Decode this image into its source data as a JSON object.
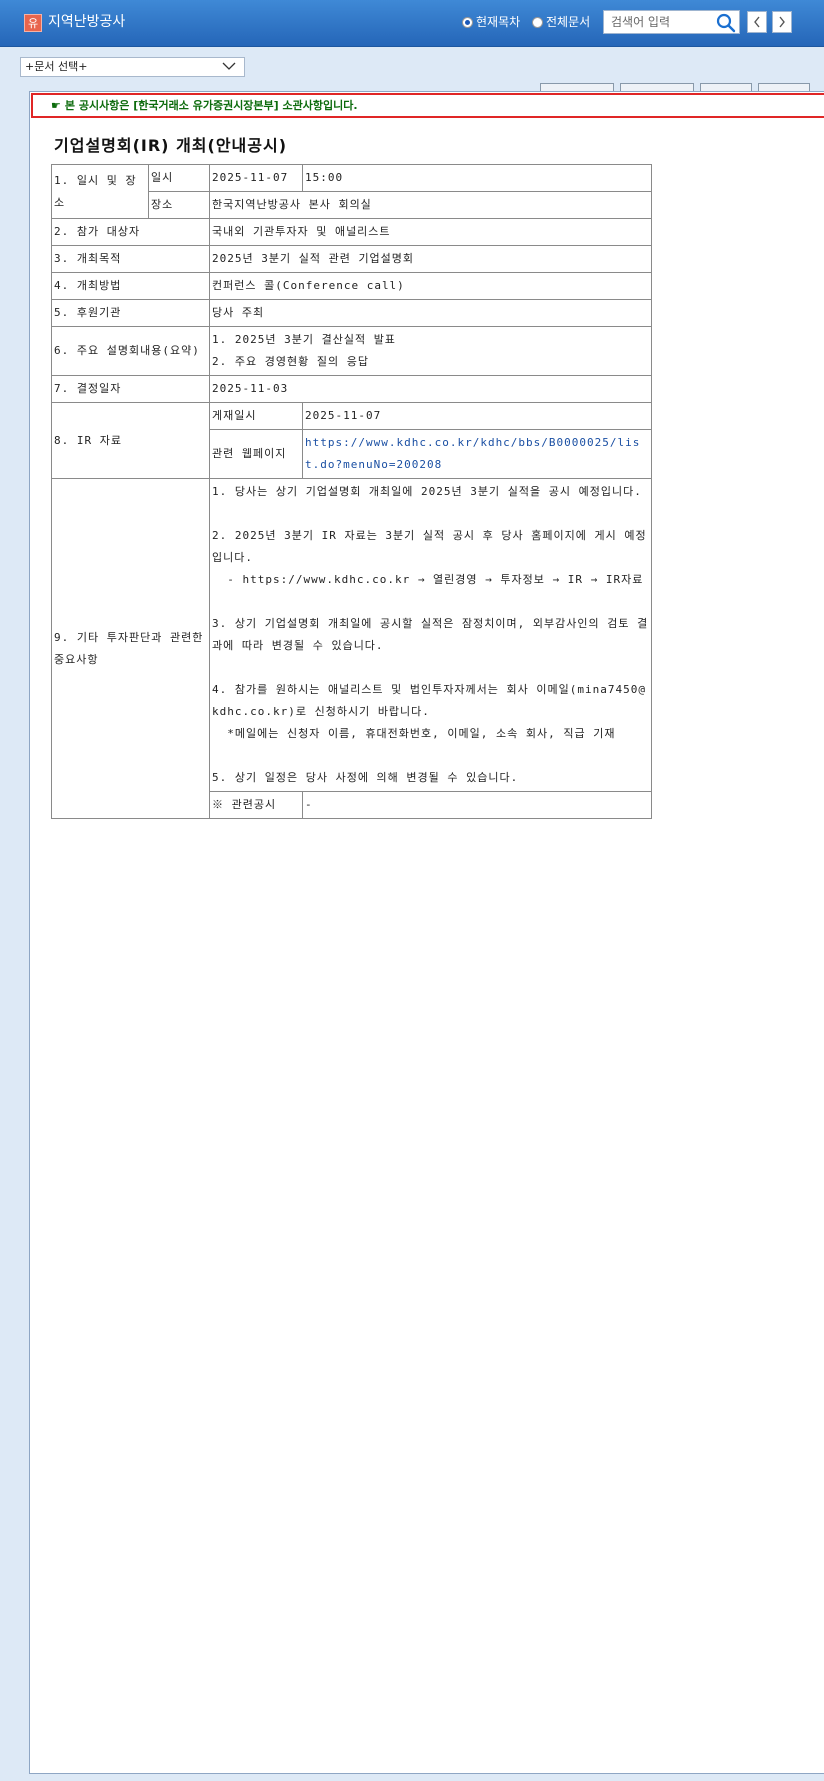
{
  "header": {
    "company_icon": "유",
    "company_name": "지역난방공사",
    "radio_current": "현재목차",
    "radio_all": "전체문서",
    "search_placeholder": "검색어 입력"
  },
  "doc_select": {
    "label": "+문서 선택+"
  },
  "notice": {
    "text": "본 공시사항은 [한국거래소 유가증권시장본부] 소관사항입니다."
  },
  "report": {
    "title": "기업설명회(IR) 개최(안내공시)",
    "rows": {
      "r1_label": "1. 일시 및 장소",
      "r1_date_label": "일시",
      "r1_date": "2025-11-07",
      "r1_time": "15:00",
      "r1_place_label": "장소",
      "r1_place": "한국지역난방공사 본사 회의실",
      "r2_label": "2. 참가 대상자",
      "r2_value": "국내외 기관투자자 및 애널리스트",
      "r3_label": "3. 개최목적",
      "r3_value": "2025년 3분기 실적 관련 기업설명회",
      "r4_label": "4. 개최방법",
      "r4_value": "컨퍼런스 콜(Conference call)",
      "r5_label": "5. 후원기관",
      "r5_value": "당사 주최",
      "r6_label": "6. 주요 설명회내용(요약)",
      "r6_line1": "1. 2025년 3분기 결산실적 발표",
      "r6_line2": "2. 주요 경영현황 질의 응답",
      "r7_label": "7. 결정일자",
      "r7_value": "2025-11-03",
      "r8_label": "8. IR 자료",
      "r8_post_label": "게재일시",
      "r8_post_value": "2025-11-07",
      "r8_web_label": "관련 웹페이지",
      "r8_web_value": "https://www.kdhc.co.kr/kdhc/bbs/B0000025/list.do?menuNo=200208",
      "r9_label": "9. 기타 투자판단과 관련한 중요사항",
      "r9_notes": [
        "1. 당사는 상기 기업설명회 개최일에 2025년 3분기 실적을 공시 예정입니다.",
        "",
        "2. 2025년 3분기 IR 자료는 3분기 실적 공시 후 당사 홈페이지에 게시 예정입니다.",
        "  - https://www.kdhc.co.kr → 열린경영 → 투자정보 → IR → IR자료",
        "",
        "3. 상기 기업설명회 개최일에 공시할 실적은 잠정치이며, 외부감사인의 검토 결과에 따라 변경될 수 있습니다.",
        "",
        "4. 참가를 원하시는 애널리스트 및 법인투자자께서는 회사 이메일(mina7450@kdhc.co.kr)로 신청하시기 바랍니다.",
        "  *메일에는 신청자 이름, 휴대전화번호, 이메일, 소속 회사, 직급 기재",
        "",
        "5. 상기 일정은 당사 사정에 의해 변경될 수 있습니다."
      ],
      "related_label": "※ 관련공시",
      "related_value": "-"
    }
  },
  "icons": {
    "search": "search-icon",
    "prev": "chevron-left-icon",
    "next": "chevron-right-icon",
    "dropdown": "chevron-down-icon",
    "notice": "pointing-hand-icon"
  },
  "colors": {
    "header_bg": "#2f78c9",
    "notice_border": "#e02626",
    "notice_text": "#0c6b0c",
    "link": "#1a4fa3"
  }
}
